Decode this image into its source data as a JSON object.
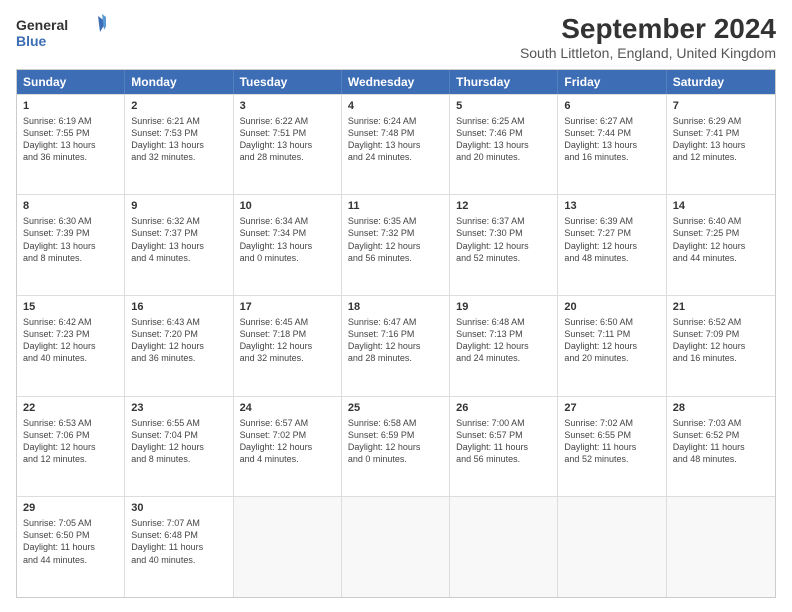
{
  "header": {
    "logo_general": "General",
    "logo_blue": "Blue",
    "title": "September 2024",
    "subtitle": "South Littleton, England, United Kingdom"
  },
  "weekdays": [
    "Sunday",
    "Monday",
    "Tuesday",
    "Wednesday",
    "Thursday",
    "Friday",
    "Saturday"
  ],
  "rows": [
    [
      {
        "day": "1",
        "info": "Sunrise: 6:19 AM\nSunset: 7:55 PM\nDaylight: 13 hours\nand 36 minutes."
      },
      {
        "day": "2",
        "info": "Sunrise: 6:21 AM\nSunset: 7:53 PM\nDaylight: 13 hours\nand 32 minutes."
      },
      {
        "day": "3",
        "info": "Sunrise: 6:22 AM\nSunset: 7:51 PM\nDaylight: 13 hours\nand 28 minutes."
      },
      {
        "day": "4",
        "info": "Sunrise: 6:24 AM\nSunset: 7:48 PM\nDaylight: 13 hours\nand 24 minutes."
      },
      {
        "day": "5",
        "info": "Sunrise: 6:25 AM\nSunset: 7:46 PM\nDaylight: 13 hours\nand 20 minutes."
      },
      {
        "day": "6",
        "info": "Sunrise: 6:27 AM\nSunset: 7:44 PM\nDaylight: 13 hours\nand 16 minutes."
      },
      {
        "day": "7",
        "info": "Sunrise: 6:29 AM\nSunset: 7:41 PM\nDaylight: 13 hours\nand 12 minutes."
      }
    ],
    [
      {
        "day": "8",
        "info": "Sunrise: 6:30 AM\nSunset: 7:39 PM\nDaylight: 13 hours\nand 8 minutes."
      },
      {
        "day": "9",
        "info": "Sunrise: 6:32 AM\nSunset: 7:37 PM\nDaylight: 13 hours\nand 4 minutes."
      },
      {
        "day": "10",
        "info": "Sunrise: 6:34 AM\nSunset: 7:34 PM\nDaylight: 13 hours\nand 0 minutes."
      },
      {
        "day": "11",
        "info": "Sunrise: 6:35 AM\nSunset: 7:32 PM\nDaylight: 12 hours\nand 56 minutes."
      },
      {
        "day": "12",
        "info": "Sunrise: 6:37 AM\nSunset: 7:30 PM\nDaylight: 12 hours\nand 52 minutes."
      },
      {
        "day": "13",
        "info": "Sunrise: 6:39 AM\nSunset: 7:27 PM\nDaylight: 12 hours\nand 48 minutes."
      },
      {
        "day": "14",
        "info": "Sunrise: 6:40 AM\nSunset: 7:25 PM\nDaylight: 12 hours\nand 44 minutes."
      }
    ],
    [
      {
        "day": "15",
        "info": "Sunrise: 6:42 AM\nSunset: 7:23 PM\nDaylight: 12 hours\nand 40 minutes."
      },
      {
        "day": "16",
        "info": "Sunrise: 6:43 AM\nSunset: 7:20 PM\nDaylight: 12 hours\nand 36 minutes."
      },
      {
        "day": "17",
        "info": "Sunrise: 6:45 AM\nSunset: 7:18 PM\nDaylight: 12 hours\nand 32 minutes."
      },
      {
        "day": "18",
        "info": "Sunrise: 6:47 AM\nSunset: 7:16 PM\nDaylight: 12 hours\nand 28 minutes."
      },
      {
        "day": "19",
        "info": "Sunrise: 6:48 AM\nSunset: 7:13 PM\nDaylight: 12 hours\nand 24 minutes."
      },
      {
        "day": "20",
        "info": "Sunrise: 6:50 AM\nSunset: 7:11 PM\nDaylight: 12 hours\nand 20 minutes."
      },
      {
        "day": "21",
        "info": "Sunrise: 6:52 AM\nSunset: 7:09 PM\nDaylight: 12 hours\nand 16 minutes."
      }
    ],
    [
      {
        "day": "22",
        "info": "Sunrise: 6:53 AM\nSunset: 7:06 PM\nDaylight: 12 hours\nand 12 minutes."
      },
      {
        "day": "23",
        "info": "Sunrise: 6:55 AM\nSunset: 7:04 PM\nDaylight: 12 hours\nand 8 minutes."
      },
      {
        "day": "24",
        "info": "Sunrise: 6:57 AM\nSunset: 7:02 PM\nDaylight: 12 hours\nand 4 minutes."
      },
      {
        "day": "25",
        "info": "Sunrise: 6:58 AM\nSunset: 6:59 PM\nDaylight: 12 hours\nand 0 minutes."
      },
      {
        "day": "26",
        "info": "Sunrise: 7:00 AM\nSunset: 6:57 PM\nDaylight: 11 hours\nand 56 minutes."
      },
      {
        "day": "27",
        "info": "Sunrise: 7:02 AM\nSunset: 6:55 PM\nDaylight: 11 hours\nand 52 minutes."
      },
      {
        "day": "28",
        "info": "Sunrise: 7:03 AM\nSunset: 6:52 PM\nDaylight: 11 hours\nand 48 minutes."
      }
    ],
    [
      {
        "day": "29",
        "info": "Sunrise: 7:05 AM\nSunset: 6:50 PM\nDaylight: 11 hours\nand 44 minutes."
      },
      {
        "day": "30",
        "info": "Sunrise: 7:07 AM\nSunset: 6:48 PM\nDaylight: 11 hours\nand 40 minutes."
      },
      {
        "day": "",
        "info": ""
      },
      {
        "day": "",
        "info": ""
      },
      {
        "day": "",
        "info": ""
      },
      {
        "day": "",
        "info": ""
      },
      {
        "day": "",
        "info": ""
      }
    ]
  ]
}
